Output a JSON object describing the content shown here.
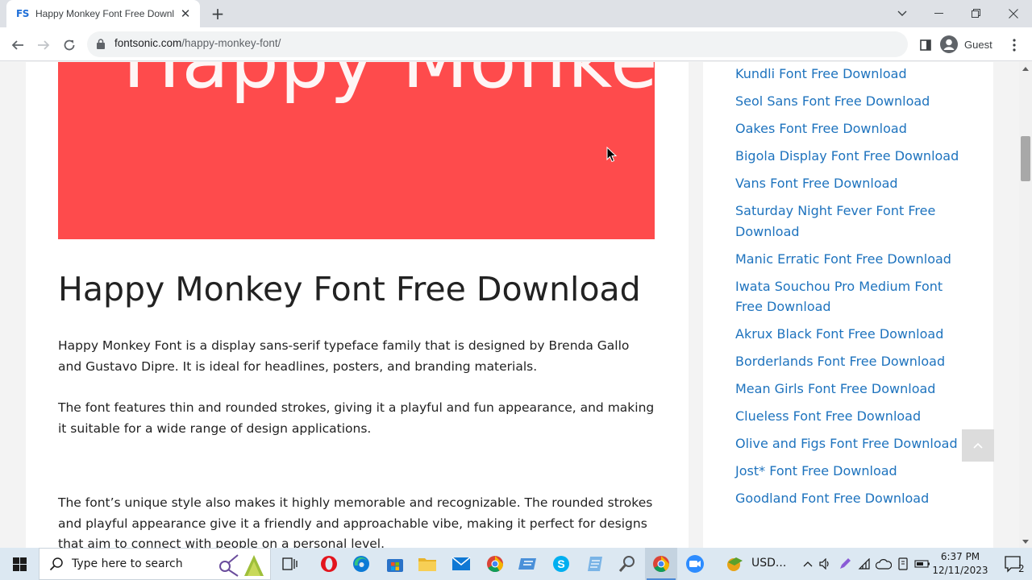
{
  "browser": {
    "tab": {
      "favicon_text": "FS",
      "title": "Happy Monkey Font Free Downl"
    },
    "url": {
      "host": "fontsonic.com",
      "path": "/happy-monkey-font/"
    },
    "profile_label": "Guest"
  },
  "page": {
    "hero_text": "Happy Monkey",
    "hero_color": "#fe4b4c",
    "heading": "Happy Monkey Font Free Download",
    "paragraphs": [
      "Happy Monkey Font is a display sans-serif typeface family that is designed by Brenda Gallo and Gustavo Dipre. It is ideal for headlines, posters, and branding materials.",
      "The font features thin and rounded strokes, giving it a playful and fun appearance, and making it suitable for a wide range of design applications.",
      "The font’s unique style also makes it highly memorable and recognizable. The rounded strokes and playful appearance give it a friendly and approachable vibe, making it perfect for designs that aim to connect with people on a personal level."
    ],
    "link_color": "#1e73be",
    "sidebar": {
      "related": [
        "Kundli Font Free Download",
        "Seol Sans Font Free Download",
        "Oakes Font Free Download",
        "Bigola Display Font Free Download",
        "Vans Font Free Download",
        "Saturday Night Fever Font Free Download",
        "Manic Erratic Font Free Download",
        "Iwata Souchou Pro Medium Font Free Download",
        "Akrux Black Font Free Download",
        "Borderlands Font Free Download",
        "Mean Girls Font Free Download",
        "Clueless Font Free Download",
        "Olive and Figs Font Free Download",
        "Jost* Font Free Download",
        "Goodland Font Free Download"
      ]
    }
  },
  "taskbar": {
    "search_placeholder": "Type here to search",
    "ticker": "USD...",
    "time": "6:37 PM",
    "date": "12/11/2023",
    "notification_count": "2"
  }
}
